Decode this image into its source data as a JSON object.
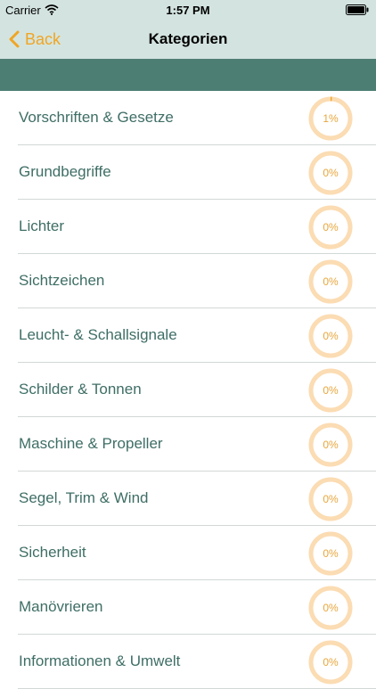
{
  "status_bar": {
    "carrier": "Carrier",
    "time": "1:57 PM"
  },
  "nav": {
    "back_label": "Back",
    "title": "Kategorien"
  },
  "colors": {
    "accent": "#f0a524",
    "header_band": "#4d7e74",
    "navbar_bg": "#d3e4e0",
    "label_text": "#3e6e65",
    "ring_track": "#fbdcb3",
    "ring_fill": "#f0a524"
  },
  "categories": [
    {
      "label": "Vorschriften & Gesetze",
      "progress_text": "1%",
      "progress": 0.01
    },
    {
      "label": "Grundbegriffe",
      "progress_text": "0%",
      "progress": 0
    },
    {
      "label": "Lichter",
      "progress_text": "0%",
      "progress": 0
    },
    {
      "label": "Sichtzeichen",
      "progress_text": "0%",
      "progress": 0
    },
    {
      "label": "Leucht- & Schallsignale",
      "progress_text": "0%",
      "progress": 0
    },
    {
      "label": "Schilder & Tonnen",
      "progress_text": "0%",
      "progress": 0
    },
    {
      "label": "Maschine & Propeller",
      "progress_text": "0%",
      "progress": 0
    },
    {
      "label": "Segel, Trim & Wind",
      "progress_text": "0%",
      "progress": 0
    },
    {
      "label": "Sicherheit",
      "progress_text": "0%",
      "progress": 0
    },
    {
      "label": "Manövrieren",
      "progress_text": "0%",
      "progress": 0
    },
    {
      "label": "Informationen & Umwelt",
      "progress_text": "0%",
      "progress": 0
    }
  ]
}
